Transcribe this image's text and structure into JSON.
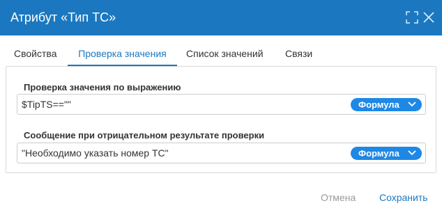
{
  "dialog": {
    "title": "Атрибут «Тип ТС»"
  },
  "tabs": [
    {
      "label": "Свойства",
      "active": false
    },
    {
      "label": "Проверка значения",
      "active": true
    },
    {
      "label": "Список значений",
      "active": false
    },
    {
      "label": "Связи",
      "active": false
    }
  ],
  "validation": {
    "expression_label": "Проверка значения по выражению",
    "expression_value": "$TipTS==\"\"",
    "expression_mode": "Формула",
    "message_label": "Сообщение при отрицательном результате проверки",
    "message_value": "\"Необходимо указать номер ТС\"",
    "message_mode": "Формула"
  },
  "footer": {
    "cancel_label": "Отмена",
    "save_label": "Сохранить"
  },
  "colors": {
    "header": "#1b78c0",
    "accent": "#1b78c0",
    "formula_button": "#1e88e5"
  }
}
